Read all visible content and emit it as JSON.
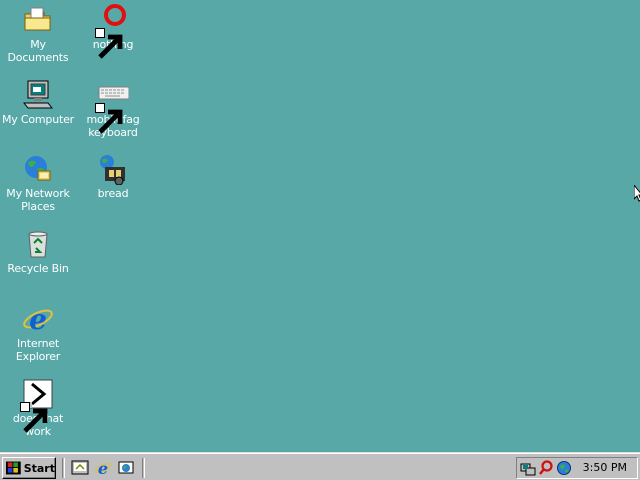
{
  "desktop": {
    "background": "#58a8a8",
    "icons": [
      {
        "label": "My Documents",
        "icon": "folder-documents-icon"
      },
      {
        "label": "nothing",
        "icon": "red-ring-icon",
        "shortcut": true
      },
      {
        "label": "My Computer",
        "icon": "computer-icon"
      },
      {
        "label": "mobilefag keyboard",
        "icon": "keyboard-icon",
        "shortcut": true
      },
      {
        "label": "My Network Places",
        "icon": "network-places-icon"
      },
      {
        "label": "bread",
        "icon": "film-globe-icon"
      },
      {
        "label": "Recycle Bin",
        "icon": "recycle-bin-icon"
      },
      {
        "label": "Internet Explorer",
        "icon": "internet-explorer-icon"
      },
      {
        "label": "does that work",
        "icon": "arrow-app-icon",
        "shortcut": true
      }
    ]
  },
  "taskbar": {
    "start_label": "Start",
    "quick_launch": [
      "show-desktop-icon",
      "internet-explorer-icon",
      "channels-icon"
    ],
    "tray_icons": [
      "network-tray-icon",
      "magnifier-tray-icon",
      "globe-tray-icon"
    ],
    "clock": "3:50 PM"
  }
}
